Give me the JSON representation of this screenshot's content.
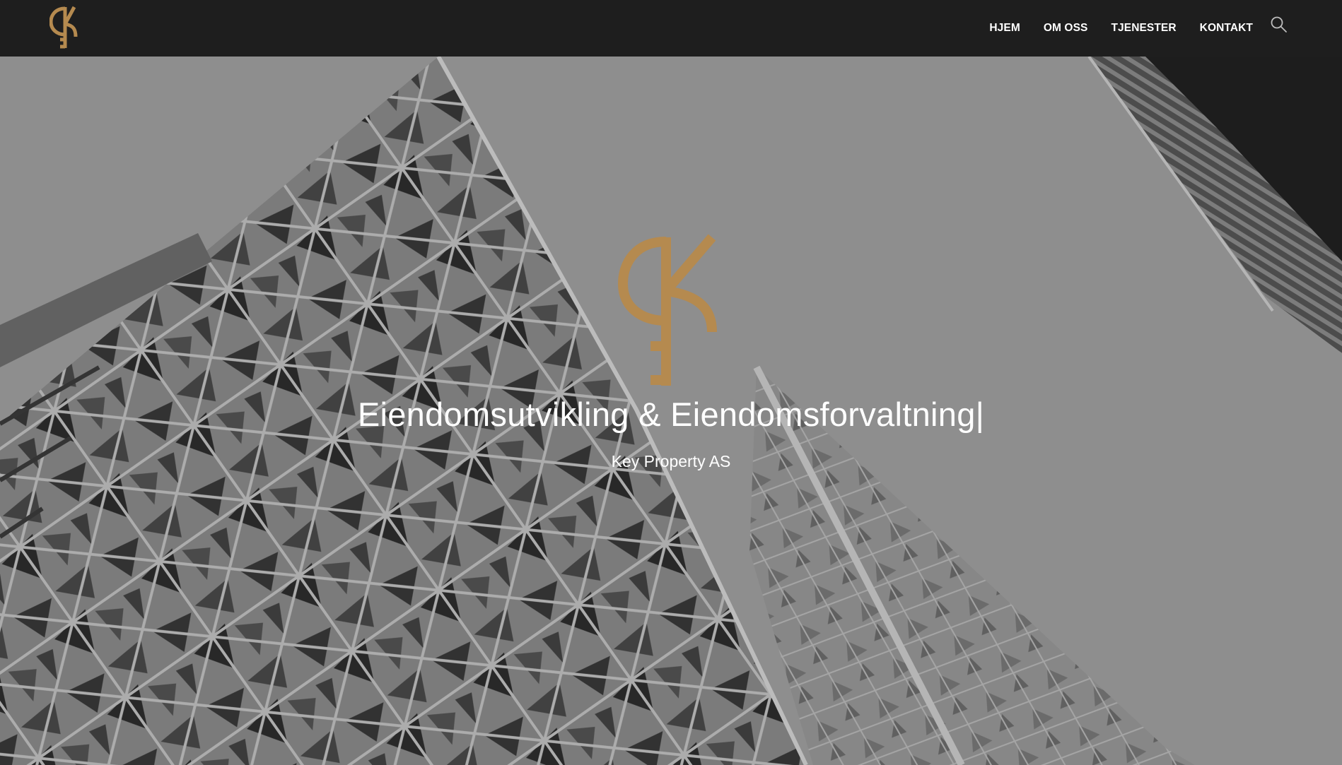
{
  "brand": {
    "logo_icon": "key-k-logo-icon",
    "accent_color": "#b58a4f"
  },
  "nav": {
    "items": [
      {
        "label": "HJEM"
      },
      {
        "label": "OM OSS"
      },
      {
        "label": "TJENESTER"
      },
      {
        "label": "KONTAKT"
      }
    ],
    "search_icon": "search-icon"
  },
  "hero": {
    "background": "grayscale-geometric-building-photo",
    "title": "Eiendomsutvikling & Eiendomsforvaltning|",
    "subtitle": "Key Property AS"
  },
  "colors": {
    "navbar_bg": "#1e1e1e",
    "text": "#ffffff"
  }
}
